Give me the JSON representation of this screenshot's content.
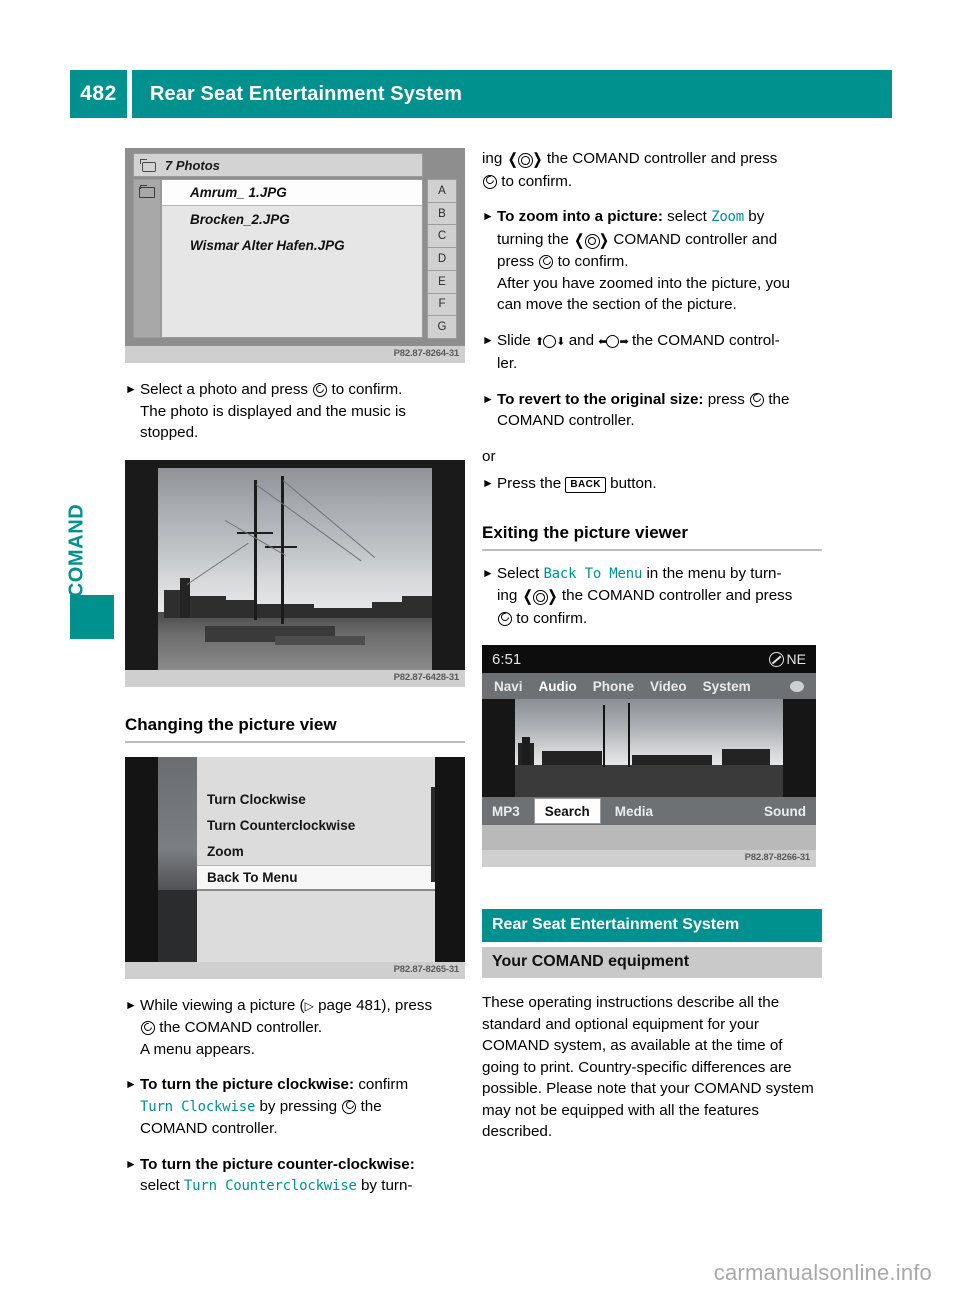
{
  "header": {
    "page_number": "482",
    "title": "Rear Seat Entertainment System",
    "accent_color": "#00918e"
  },
  "sidebar": {
    "vertical_label": "COMAND"
  },
  "figures": {
    "photo_list": {
      "title": "7 Photos",
      "items": [
        "Amrum_ 1.JPG",
        "Brocken_2.JPG",
        "Wismar Alter Hafen.JPG"
      ],
      "letters": [
        "A",
        "B",
        "C",
        "D",
        "E",
        "F",
        "G"
      ],
      "caption": "P82.87-8264-31"
    },
    "harbour_photo": {
      "caption": "P82.87-6428-31"
    },
    "picture_menu": {
      "items": [
        "Turn Clockwise",
        "Turn Counterclockwise",
        "Zoom",
        "Back To Menu"
      ],
      "selected": "Back To Menu",
      "caption": "P82.87-8265-31"
    },
    "comand_screen": {
      "time": "6:51",
      "compass": "NE",
      "nav_items": [
        "Navi",
        "Audio",
        "Phone",
        "Video",
        "System"
      ],
      "nav_active": "Audio",
      "bottom_items": [
        "MP3",
        "Search",
        "Media",
        "Sound"
      ],
      "bottom_active": "Search",
      "caption": "P82.87-8266-31"
    }
  },
  "left_column": {
    "step_select_photo": {
      "line1_a": "Select a photo and press",
      "line1_b": "to confirm.",
      "line2": "The photo is displayed and the music is",
      "line3": "stopped."
    },
    "heading_changing_view": "Changing the picture view",
    "step_while_viewing": {
      "a": "While viewing a picture (",
      "page_ref": "page 481",
      "b": "), press",
      "c": "the COMAND controller.",
      "d": "A menu appears."
    },
    "step_clockwise": {
      "bold": "To turn the picture clockwise:",
      "a": "confirm",
      "code": "Turn Clockwise",
      "b": "by pressing",
      "c": "the",
      "d": "COMAND controller."
    },
    "step_counterclockwise": {
      "bold": "To turn the picture counter-clockwise:",
      "a": "select",
      "code": "Turn Counterclockwise",
      "b": "by turn-"
    }
  },
  "right_column": {
    "cont_turning": {
      "a": "ing",
      "b": "the COMAND controller and press",
      "c": "to confirm."
    },
    "step_zoom": {
      "bold": "To zoom into a picture:",
      "a": "select",
      "code": "Zoom",
      "b": "by",
      "c": "turning the",
      "d": "COMAND controller and",
      "e": "press",
      "f": "to confirm.",
      "g": "After you have zoomed into the picture, you",
      "h": "can move the section of the picture."
    },
    "step_slide": {
      "a": "Slide",
      "b": "and",
      "c": "the COMAND control-",
      "d": "ler."
    },
    "step_revert": {
      "bold": "To revert to the original size:",
      "a": "press",
      "b": "the",
      "c": "COMAND controller."
    },
    "or_text": "or",
    "step_back_button": {
      "a": "Press the",
      "button": "BACK",
      "b": "button."
    },
    "heading_exiting": "Exiting the picture viewer",
    "step_exit": {
      "a": "Select",
      "code": "Back To Menu",
      "b": "in the menu by turn-",
      "c": "ing",
      "d": "the COMAND controller and press",
      "e": "to confirm."
    },
    "teal_heading": "Rear Seat Entertainment System",
    "grey_heading": "Your COMAND equipment",
    "body_paragraph": "These operating instructions describe all the standard and optional equipment for your COMAND system, as available at the time of going to print. Country-specific differences are possible. Please note that your COMAND system may not be equipped with all the features described."
  },
  "footer": {
    "watermark": "carmanualsonline.info"
  }
}
